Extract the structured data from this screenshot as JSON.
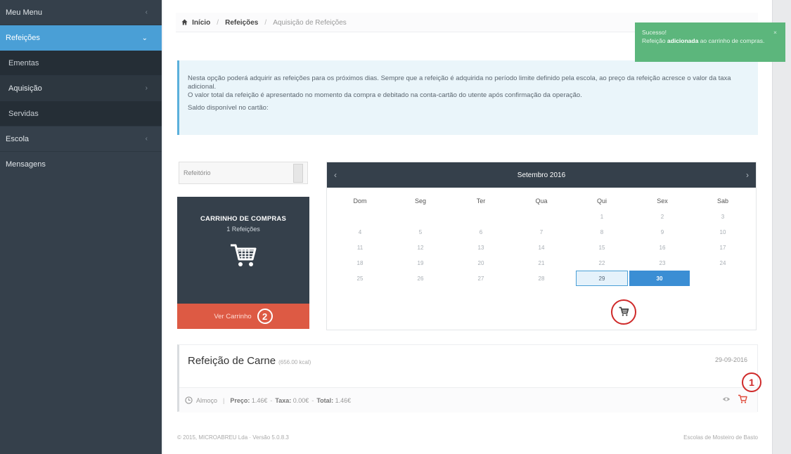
{
  "sidebar": {
    "items": [
      {
        "label": "Meu Menu"
      },
      {
        "label": "Refeições"
      },
      {
        "label": "Ementas"
      },
      {
        "label": "Aquisição"
      },
      {
        "label": "Servidas"
      },
      {
        "label": "Escola"
      },
      {
        "label": "Mensagens"
      }
    ]
  },
  "breadcrumb": {
    "home": "Início",
    "section": "Refeições",
    "current": "Aquisição de Refeições"
  },
  "info": {
    "line1": "Nesta opção poderá adquirir as refeições para os próximos dias. Sempre que a refeição é adquirida no período limite definido pela escola, ao preço da refeição acresce o valor da taxa adicional.",
    "line2": "O valor total da refeição é apresentado no momento da compra e debitado na conta-cartão do utente após confirmação da operação.",
    "saldo": "Saldo disponível no cartão:"
  },
  "filter": {
    "value": "Refeitório"
  },
  "cart": {
    "title": "CARRINHO DE COMPRAS",
    "count": "1 Refeições",
    "button": "Ver Carrinho",
    "marker": "2"
  },
  "calendar": {
    "month": "Setembro 2016",
    "prev": "‹",
    "next": "›",
    "days": [
      "Dom",
      "Seg",
      "Ter",
      "Qua",
      "Qui",
      "Sex",
      "Sab"
    ],
    "cells": [
      "",
      "",
      "",
      "",
      "1",
      "2",
      "3",
      "4",
      "5",
      "6",
      "7",
      "8",
      "9",
      "10",
      "11",
      "12",
      "13",
      "14",
      "15",
      "16",
      "17",
      "18",
      "19",
      "20",
      "21",
      "22",
      "23",
      "24",
      "25",
      "26",
      "27",
      "28",
      "29",
      "30",
      ""
    ],
    "selected_day": "29",
    "today": "30"
  },
  "meal": {
    "title": "Refeição de Carne",
    "kcal": "(656.00 kcal)",
    "date": "29-09-2016",
    "period": "Almoço",
    "price_label": "Preço:",
    "price": "1.46€",
    "tax_label": "Taxa:",
    "tax": "0.00€",
    "total_label": "Total:",
    "total": "1.46€",
    "marker": "1"
  },
  "footer": {
    "left": "© 2015, MICROABREU Lda · Versão 5.0.8.3",
    "right": "Escolas de Mosteiro de Basto"
  },
  "toast": {
    "title": "Sucesso!",
    "msg_a": "Refeição ",
    "msg_b": "adicionada",
    "msg_c": " ao carrinho de compras.",
    "close": "×"
  },
  "colors": {
    "sidebar": "#35404b",
    "accent": "#4a9fd6",
    "cart_button": "#dd5a44",
    "success": "#5cb67c",
    "marker": "#cf2a2a"
  }
}
